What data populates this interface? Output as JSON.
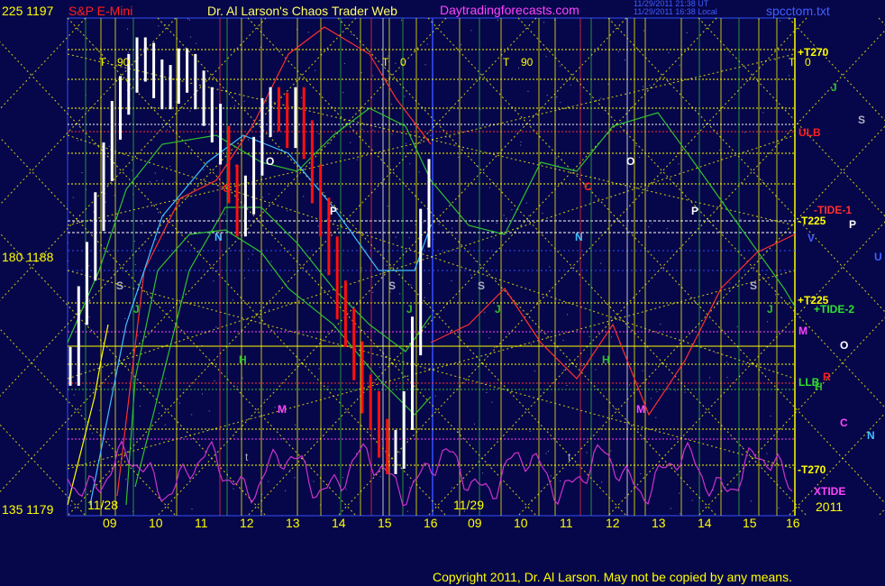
{
  "header": {
    "title_left": "S&P E-Mini",
    "title_center": "Dr. Al Larson's Chaos Trader Web",
    "website": "Daytradingforecasts.com",
    "timestamp_ut": "11/29/2011 21:38 UT",
    "timestamp_local": "11/29/2011 16:38 Local",
    "filename": "spcctom.txt"
  },
  "copyright": "Copyright 2011, Dr. Al Larson. May not be copied by any means.",
  "y_axis_labels": [
    {
      "angle": "225",
      "price": "1197"
    },
    {
      "angle": "180",
      "price": "1188"
    },
    {
      "angle": "135",
      "price": "1179"
    }
  ],
  "x_axis": {
    "date_labels": [
      "11/28",
      "11/29"
    ],
    "hour_labels": [
      "09",
      "10",
      "11",
      "12",
      "13",
      "14",
      "15",
      "16",
      "09",
      "10",
      "11",
      "12",
      "13",
      "14",
      "15",
      "16"
    ],
    "year": "2011"
  },
  "tide_markers": [
    "T",
    "90",
    "T",
    "0",
    "T",
    "90",
    "T",
    "0"
  ],
  "right_labels": {
    "plus_t270": "+T270",
    "ulb": "ULB",
    "minus_tide1": "-TIDE-1",
    "minus_t225": "-T225",
    "plus_t225": "+T225",
    "plus_tide2": "+TIDE-2",
    "llb": "LLB",
    "minus_t270": "-T270",
    "xtide": "XTIDE"
  },
  "planet_letters": [
    "J",
    "S",
    "P",
    "V",
    "U",
    "M",
    "O",
    "R",
    "H",
    "C",
    "N"
  ],
  "chart_letters": [
    "O",
    "C",
    "N",
    "S",
    "P",
    "J",
    "H",
    "M",
    "t"
  ],
  "colors": {
    "background": "#06064a",
    "header_title": "#ff2020",
    "header_center": "#ffff66",
    "website": "#ff44ff",
    "timestamp": "#4060ff",
    "axis_yellow": "#ffff00",
    "bar_white": "#ffffff",
    "bar_red": "#ff1010",
    "xtide_magenta": "#cc33cc"
  },
  "chart_data": {
    "type": "line",
    "title": "S&P E-Mini",
    "ylim": [
      1179,
      1197
    ],
    "x_sessions": [
      "11/28",
      "11/29"
    ],
    "series": [
      {
        "name": "price",
        "values": [
          1184.4,
          1186.6,
          1188.2,
          1190.0,
          1191.8,
          1193.3,
          1194.2,
          1195.0,
          1195.6,
          1195.4,
          1194.8,
          1194.4,
          1194.6,
          1195.2,
          1195.0,
          1194.4,
          1193.8,
          1193.2,
          1192.4,
          1191.0,
          1189.8,
          1190.6,
          1192.0,
          1193.4,
          1193.8,
          1193.6,
          1193.0,
          1193.8,
          1192.6,
          1191.0,
          1189.8,
          1188.4,
          1186.8,
          1185.8,
          1184.6,
          1183.4,
          1182.8,
          1181.8,
          1181.2,
          1181.4,
          1182.8,
          1185.5,
          1189.4,
          1191.2
        ]
      },
      {
        "name": "XTIDE",
        "values": []
      },
      {
        "name": "ULB",
        "values": []
      },
      {
        "name": "LLB",
        "values": []
      }
    ]
  }
}
